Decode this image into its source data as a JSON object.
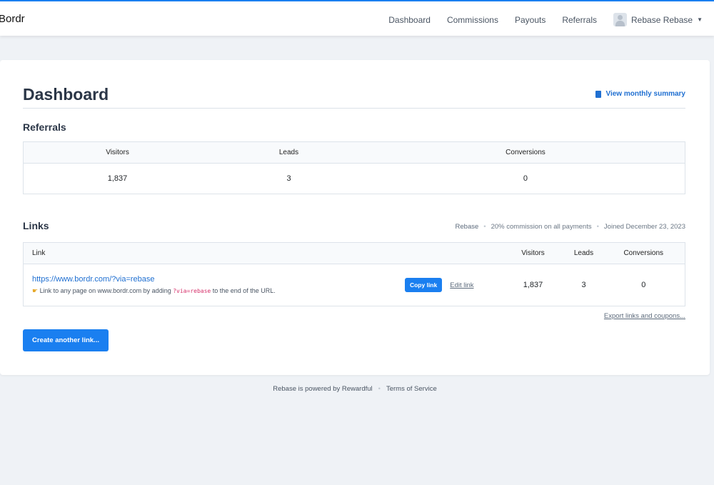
{
  "header": {
    "brand": "Bordr",
    "nav": [
      "Dashboard",
      "Commissions",
      "Payouts",
      "Referrals"
    ],
    "user": "Rebase Rebase"
  },
  "page": {
    "title": "Dashboard",
    "summary_link": "View monthly summary"
  },
  "referrals": {
    "title": "Referrals",
    "headers": [
      "Visitors",
      "Leads",
      "Conversions"
    ],
    "values": [
      "1,837",
      "3",
      "0"
    ]
  },
  "links": {
    "title": "Links",
    "meta": {
      "name": "Rebase",
      "commission": "20% commission on all payments",
      "joined": "Joined December 23, 2023"
    },
    "headers": [
      "Link",
      "Visitors",
      "Leads",
      "Conversions"
    ],
    "row": {
      "url": "https://www.bordr.com/?via=rebase",
      "hint_prefix": "Link to any page on www.bordr.com by adding",
      "hint_code": "?via=rebase",
      "hint_suffix": "to the end of the URL.",
      "copy": "Copy link",
      "edit": "Edit link",
      "visitors": "1,837",
      "leads": "3",
      "conversions": "0"
    },
    "export": "Export links and coupons...",
    "create": "Create another link..."
  },
  "footer": {
    "powered": "Rebase is powered by Rewardful",
    "terms": "Terms of Service"
  }
}
